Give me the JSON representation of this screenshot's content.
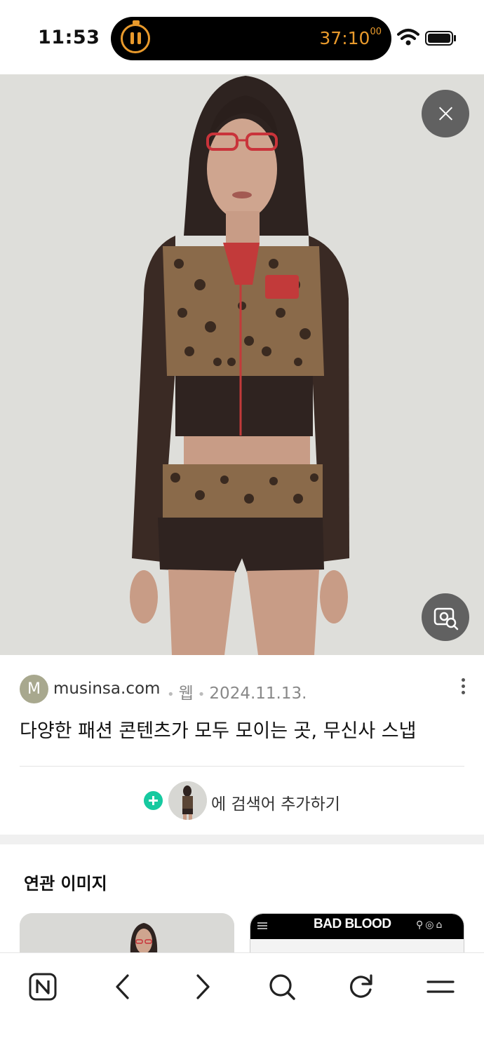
{
  "status_bar": {
    "time": "11:53",
    "timer_main": "37:10",
    "timer_fraction": "00",
    "accent_color": "#e99a2c",
    "icons": [
      "pause-icon",
      "wifi-icon",
      "battery-icon"
    ]
  },
  "viewer": {
    "close_icon": "close-icon",
    "lens_icon": "image-search-icon"
  },
  "result": {
    "favicon_letter": "M",
    "favicon_color": "#a8a88e",
    "site": "musinsa.com",
    "type": "웹",
    "date": "2024.11.13.",
    "title": "다양한 패션 콘텐츠가 모두 모이는 곳, 무신사 스냅",
    "add_search_label": "에 검색어 추가하기",
    "add_icon_color": "#16c9a0"
  },
  "related": {
    "title": "연관 이미지",
    "thumb2_brand": "BAD BLOOD"
  },
  "bottom_nav": {
    "items": [
      "naver-home-icon",
      "back-icon",
      "forward-icon",
      "search-icon",
      "refresh-icon",
      "menu-icon"
    ]
  }
}
